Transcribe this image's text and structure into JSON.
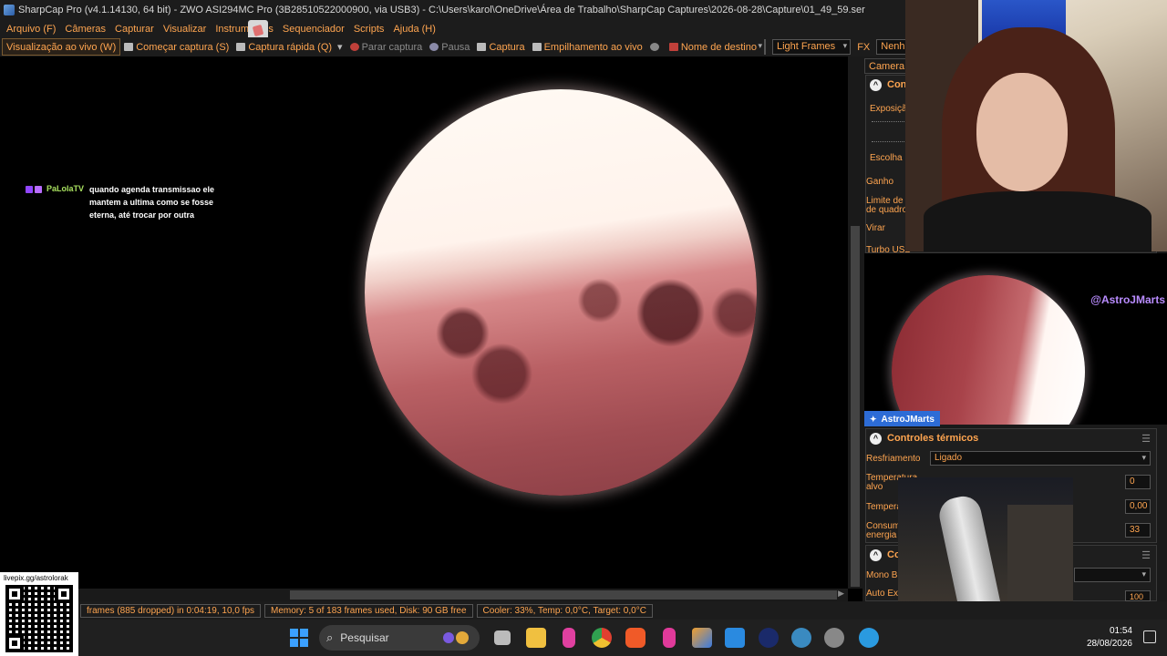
{
  "window": {
    "title": "SharpCap Pro (v4.1.14130, 64 bit) - ZWO ASI294MC Pro (3B28510522000900, via USB3) - C:\\Users\\karol\\OneDrive\\Área de Trabalho\\SharpCap Captures\\2026-08-28\\Capture\\01_49_59.ser"
  },
  "menu": [
    {
      "label": "Arquivo (F)"
    },
    {
      "label": "Câmeras"
    },
    {
      "label": "Capturar"
    },
    {
      "label": "Visualizar"
    },
    {
      "label": "Instrumentos"
    },
    {
      "label": "Sequenciador"
    },
    {
      "label": "Scripts"
    },
    {
      "label": "Ajuda (H)"
    }
  ],
  "toolbar": {
    "live_view": "Visualização ao vivo (W)",
    "start_capture": "Começar captura (S)",
    "quick_capture": "Captura rápida (Q)",
    "stop_capture": "Parar captura",
    "pause": "Pausa",
    "snapshot": "Captura",
    "live_stack": "Empilhamento ao vivo",
    "target_name_label": "Nome de destino",
    "frame_type": "Light Frames",
    "fx_label": "FX",
    "fx_value": "Nenhum"
  },
  "chat": {
    "user": "PaLolaTV",
    "message": "quando agenda transmissao ele mantem a ultima como se fosse eterna, até trocar por outra"
  },
  "side_panel": {
    "tab": "Camera C",
    "camera_group": {
      "title": "Cont",
      "exposure_label": "Exposiçã",
      "choose_label": "Escolha",
      "gain_label": "Ganho",
      "frame_limit_label_1": "Limite de f",
      "frame_limit_label_2": "de quadro",
      "flip_label": "Virar",
      "turbo_label": "Turbo USB"
    },
    "thermal": {
      "title": "Controles térmicos",
      "cooling_label": "Resfriamento",
      "cooling_value": "Ligado",
      "target_temp_label_1": "Temperatura",
      "target_temp_label_2": "alvo",
      "target_temp_value": "0",
      "temp_label": "Tempera",
      "temp_value": "0,00",
      "power_label_1": "Consum",
      "power_label_2": "energia",
      "power_value": "33"
    },
    "color_group": {
      "title": "Co",
      "mono_label": "Mono Bi",
      "auto_label": "Auto Ex",
      "auto_value": "100"
    }
  },
  "overlay": {
    "handle": "@AstroJMarts",
    "streamer": "AstroJMarts",
    "qr_label": "livepix.gg/astrolorak"
  },
  "statusbar": {
    "frames": "frames (885 dropped) in 0:04:19, 10,0 fps",
    "memory": "Memory: 5 of 183 frames used, Disk: 90 GB free",
    "cooler": "Cooler: 33%, Temp: 0,0°C, Target: 0,0°C"
  },
  "taskbar": {
    "search_placeholder": "Pesquisar",
    "time": "01:54",
    "date": "28/08/2026"
  },
  "colors": {
    "accent": "#ffa550",
    "background": "#1c1c1c",
    "streamer_tag": "#2d6cd6",
    "handle": "#b98cff"
  }
}
